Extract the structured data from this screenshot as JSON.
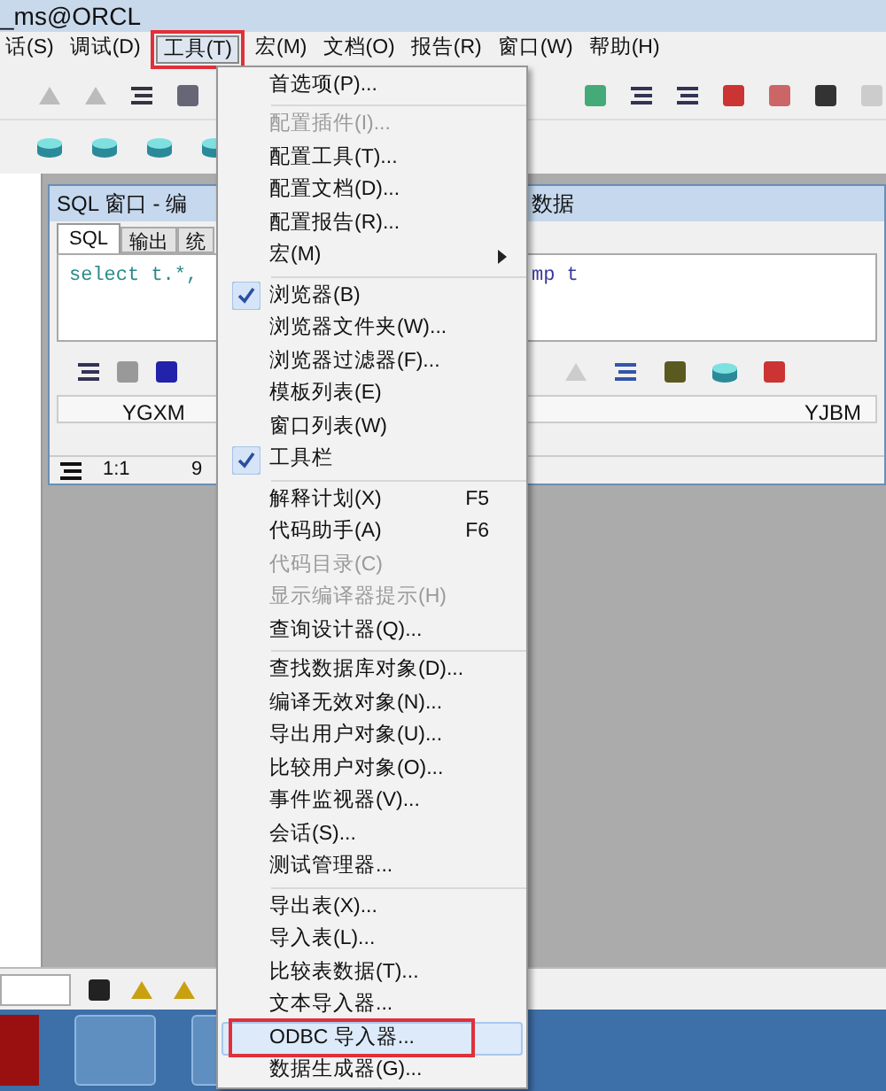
{
  "window": {
    "title": "_ms@ORCL"
  },
  "menu_bar": [
    {
      "label": "话(S)",
      "selected": false
    },
    {
      "label": "调试(D)",
      "selected": false
    },
    {
      "label": "工具(T)",
      "selected": true
    },
    {
      "label": "宏(M)",
      "selected": false
    },
    {
      "label": "文档(O)",
      "selected": false
    },
    {
      "label": "报告(R)",
      "selected": false
    },
    {
      "label": "窗口(W)",
      "selected": false
    },
    {
      "label": "帮助(H)",
      "selected": false
    }
  ],
  "sql_window": {
    "title_start": "SQL 窗口 - 编",
    "title_end": "数据",
    "tabs": [
      {
        "label": "SQL",
        "selected": true
      },
      {
        "label": "输出",
        "selected": false
      },
      {
        "label": "统",
        "selected": false
      }
    ],
    "editor_start": "select t.*,",
    "editor_end": "mp t",
    "columns": [
      "YGXM",
      "YJBM"
    ],
    "status": [
      "1:1",
      "9"
    ]
  },
  "tools_menu": [
    {
      "kind": "item",
      "label": "首选项(P)...",
      "checked": false,
      "disabled": false,
      "selected": false
    },
    {
      "kind": "separator"
    },
    {
      "kind": "item",
      "label": "配置插件(I)...",
      "checked": false,
      "disabled": true,
      "selected": false
    },
    {
      "kind": "item",
      "label": "配置工具(T)...",
      "checked": false,
      "disabled": false,
      "selected": false
    },
    {
      "kind": "item",
      "label": "配置文档(D)...",
      "checked": false,
      "disabled": false,
      "selected": false
    },
    {
      "kind": "item",
      "label": "配置报告(R)...",
      "checked": false,
      "disabled": false,
      "selected": false
    },
    {
      "kind": "submenu",
      "label": "宏(M)",
      "checked": false,
      "disabled": false,
      "selected": false
    },
    {
      "kind": "separator"
    },
    {
      "kind": "item",
      "label": "浏览器(B)",
      "checked": true,
      "disabled": false,
      "selected": false
    },
    {
      "kind": "item",
      "label": "浏览器文件夹(W)...",
      "checked": false,
      "disabled": false,
      "selected": false
    },
    {
      "kind": "item",
      "label": "浏览器过滤器(F)...",
      "checked": false,
      "disabled": false,
      "selected": false
    },
    {
      "kind": "item",
      "label": "模板列表(E)",
      "checked": false,
      "disabled": false,
      "selected": false
    },
    {
      "kind": "item",
      "label": "窗口列表(W)",
      "checked": false,
      "disabled": false,
      "selected": false
    },
    {
      "kind": "item",
      "label": "工具栏",
      "checked": true,
      "disabled": false,
      "selected": false
    },
    {
      "kind": "separator"
    },
    {
      "kind": "item",
      "label": "解释计划(X)",
      "shortcut": "F5",
      "checked": false,
      "disabled": false,
      "selected": false
    },
    {
      "kind": "item",
      "label": "代码助手(A)",
      "shortcut": "F6",
      "checked": false,
      "disabled": false,
      "selected": false
    },
    {
      "kind": "item",
      "label": "代码目录(C)",
      "checked": false,
      "disabled": true,
      "selected": false
    },
    {
      "kind": "item",
      "label": "显示编译器提示(H)",
      "checked": false,
      "disabled": true,
      "selected": false
    },
    {
      "kind": "item",
      "label": "查询设计器(Q)...",
      "checked": false,
      "disabled": false,
      "selected": false
    },
    {
      "kind": "separator"
    },
    {
      "kind": "item",
      "label": "查找数据库对象(D)...",
      "checked": false,
      "disabled": false,
      "selected": false
    },
    {
      "kind": "item",
      "label": "编译无效对象(N)...",
      "checked": false,
      "disabled": false,
      "selected": false
    },
    {
      "kind": "item",
      "label": "导出用户对象(U)...",
      "checked": false,
      "disabled": false,
      "selected": false
    },
    {
      "kind": "item",
      "label": "比较用户对象(O)...",
      "checked": false,
      "disabled": false,
      "selected": false
    },
    {
      "kind": "item",
      "label": "事件监视器(V)...",
      "checked": false,
      "disabled": false,
      "selected": false
    },
    {
      "kind": "item",
      "label": "会话(S)...",
      "checked": false,
      "disabled": false,
      "selected": false
    },
    {
      "kind": "item",
      "label": "测试管理器...",
      "checked": false,
      "disabled": false,
      "selected": false
    },
    {
      "kind": "separator"
    },
    {
      "kind": "item",
      "label": "导出表(X)...",
      "checked": false,
      "disabled": false,
      "selected": false
    },
    {
      "kind": "item",
      "label": "导入表(L)...",
      "checked": false,
      "disabled": false,
      "selected": false
    },
    {
      "kind": "item",
      "label": "比较表数据(T)...",
      "checked": false,
      "disabled": false,
      "selected": false
    },
    {
      "kind": "item",
      "label": "文本导入器...",
      "checked": false,
      "disabled": false,
      "selected": false
    },
    {
      "kind": "item",
      "label": "ODBC 导入器...",
      "checked": false,
      "disabled": false,
      "selected": true
    },
    {
      "kind": "item",
      "label": "数据生成器(G)...",
      "checked": false,
      "disabled": false,
      "selected": false
    }
  ]
}
